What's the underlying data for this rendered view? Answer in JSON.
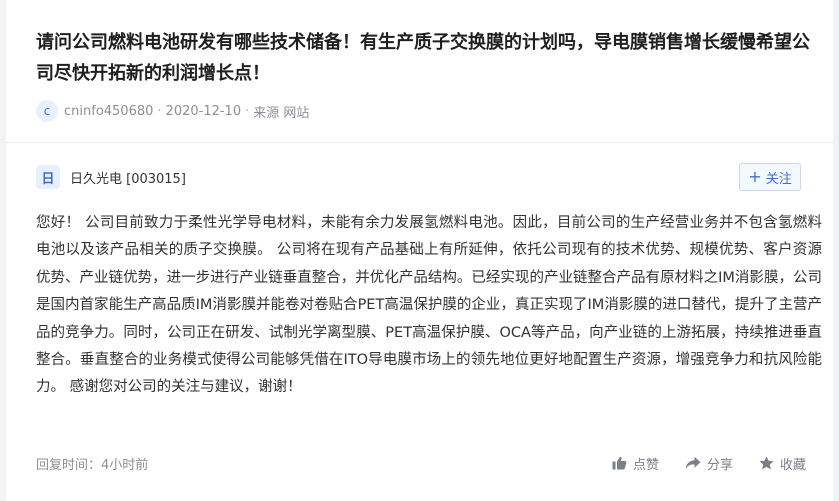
{
  "question": {
    "title": "请问公司燃料电池研发有哪些技术储备！有生产质子交换膜的计划吗，导电膜销售增长缓慢希望公司尽快开拓新的利润增长点！",
    "avatar_letter": "c",
    "username": "cninfo450680",
    "date": "2020-12-10",
    "source": "来源 网站"
  },
  "answer": {
    "company_badge": "日",
    "company_name": "日久光电 [003015]",
    "follow_label": "关注",
    "text": "您好！ 公司目前致力于柔性光学导电材料，未能有余力发展氢燃料电池。因此，目前公司的生产经营业务并不包含氢燃料电池以及该产品相关的质子交换膜。 公司将在现有产品基础上有所延伸，依托公司现有的技术优势、规模优势、客户资源优势、产业链优势，进一步进行产业链垂直整合，并优化产品结构。已经实现的产业链整合产品有原材料之IM消影膜，公司是国内首家能生产高品质IM消影膜并能卷对卷贴合PET高温保护膜的企业，真正实现了IM消影膜的进口替代，提升了主营产品的竞争力。同时，公司正在研发、试制光学离型膜、PET高温保护膜、OCA等产品，向产业链的上游拓展，持续推进垂直整合。垂直整合的业务模式使得公司能够凭借在ITO导电膜市场上的领先地位更好地配置生产资源，增强竞争力和抗风险能力。 感谢您对公司的关注与建议，谢谢！",
    "reply_time": "回复时间：4小时前",
    "actions": {
      "like": "点赞",
      "share": "分享",
      "favorite": "收藏"
    }
  },
  "colors": {
    "accent": "#3b6fd8",
    "muted": "#8a8f99",
    "background": "#f2f3f5"
  },
  "icons": [
    "thumbs-up-icon",
    "share-arrow-icon",
    "star-icon",
    "plus-icon"
  ]
}
